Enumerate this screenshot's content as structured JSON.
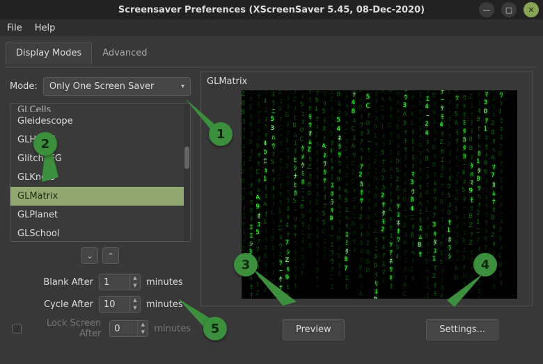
{
  "window": {
    "title": "Screensaver Preferences  (XScreenSaver 5.45, 08-Dec-2020)"
  },
  "menubar": {
    "file": "File",
    "help": "Help"
  },
  "tabs": {
    "display_modes": "Display Modes",
    "advanced": "Advanced"
  },
  "mode": {
    "label": "Mode:",
    "value": "Only One Screen Saver"
  },
  "saver_list": {
    "items": [
      {
        "label": "GLCells"
      },
      {
        "label": "Gleidescope"
      },
      {
        "label": "GLHanoi"
      },
      {
        "label": "GlitchPEG"
      },
      {
        "label": "GLKnots"
      },
      {
        "label": "GLMatrix"
      },
      {
        "label": "GLPlanet"
      },
      {
        "label": "GLSchool"
      }
    ],
    "selected_index": 5
  },
  "timing": {
    "blank_after_label": "Blank After",
    "blank_after_value": "1",
    "cycle_after_label": "Cycle After",
    "cycle_after_value": "10",
    "lock_after_label": "Lock Screen After",
    "lock_after_value": "0",
    "unit": "minutes"
  },
  "preview": {
    "title": "GLMatrix",
    "preview_button": "Preview",
    "settings_button": "Settings..."
  },
  "annotations": {
    "b1": "1",
    "b2": "2",
    "b3": "3",
    "b4": "4",
    "b5": "5"
  }
}
